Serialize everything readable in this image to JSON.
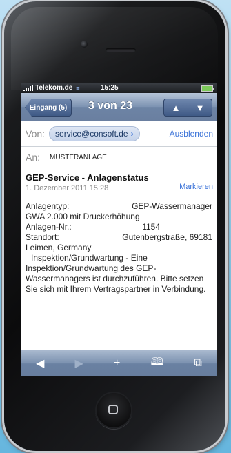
{
  "status_bar": {
    "carrier": "Telekom.de",
    "time": "15:25"
  },
  "nav": {
    "back_label": "Eingang (5)",
    "position": "3 von 23",
    "up": "▲",
    "down": "▼"
  },
  "header": {
    "from_label": "Von:",
    "sender": "service@consoft.de",
    "hide_label": "Ausblenden",
    "to_label": "An:",
    "recipient": "MUSTERANLAGE"
  },
  "message": {
    "subject": "GEP-Service - Anlagenstatus",
    "date": "1. Dezember 2011 15:28",
    "mark_label": "Markieren",
    "type_label": "Anlagentyp:",
    "type_value": "GEP-Wassermanager",
    "type_line2": "GWA 2.000 mit Druckerhöhung",
    "number_label": "Anlagen-Nr.:",
    "number_value": "1154",
    "location_label": "Standort:",
    "location_value": "Gutenbergstraße, 69181",
    "location_line2": "Leimen, Germany",
    "paragraph": "Inspektion/Grundwartung - Eine Inspektion/Grundwartung des GEP-Wassermanagers ist durchzuführen. Bitte setzen Sie sich mit Ihrem Vertragspartner in Verbindung."
  },
  "toolbar": {
    "back": "◀",
    "forward": "▶",
    "add": "+",
    "bookmarks": "🕮",
    "pages": "⧉"
  }
}
